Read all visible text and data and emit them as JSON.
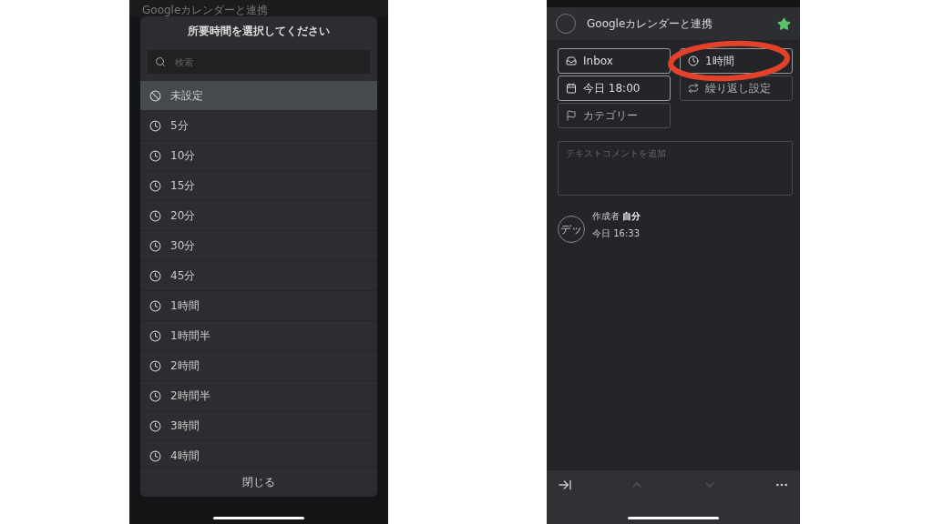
{
  "left_phone": {
    "task_title": "Googleカレンダーと連携",
    "dialog": {
      "title": "所要時間を選択してください",
      "search": {
        "placeholder": "検索"
      },
      "options": [
        {
          "label": "未設定",
          "kind": "none",
          "selected": true
        },
        {
          "label": "5分",
          "kind": "duration",
          "selected": false
        },
        {
          "label": "10分",
          "kind": "duration",
          "selected": false
        },
        {
          "label": "15分",
          "kind": "duration",
          "selected": false
        },
        {
          "label": "20分",
          "kind": "duration",
          "selected": false
        },
        {
          "label": "30分",
          "kind": "duration",
          "selected": false
        },
        {
          "label": "45分",
          "kind": "duration",
          "selected": false
        },
        {
          "label": "1時間",
          "kind": "duration",
          "selected": false
        },
        {
          "label": "1時間半",
          "kind": "duration",
          "selected": false
        },
        {
          "label": "2時間",
          "kind": "duration",
          "selected": false
        },
        {
          "label": "2時間半",
          "kind": "duration",
          "selected": false
        },
        {
          "label": "3時間",
          "kind": "duration",
          "selected": false
        },
        {
          "label": "4時間",
          "kind": "duration",
          "selected": false
        }
      ],
      "close": "閉じる"
    }
  },
  "right_phone": {
    "task": {
      "title": "Googleカレンダーと連携",
      "done": false,
      "starred": true
    },
    "properties": [
      {
        "label": "Inbox",
        "kind": "inbox",
        "set": true
      },
      {
        "label": "1時間",
        "kind": "duration",
        "set": true
      },
      {
        "label": "今日 18:00",
        "kind": "date",
        "set": true
      },
      {
        "label": "繰り返し設定",
        "kind": "repeat",
        "set": false
      },
      {
        "label": "カテゴリー",
        "kind": "category",
        "set": false
      }
    ],
    "comment": {
      "placeholder": "テキストコメントを追加"
    },
    "activity": {
      "avatar": "デッ",
      "author": "作成者 **自分**",
      "time": "今日 16:33"
    },
    "toolbar": [
      {
        "kind": "move",
        "disabled": false
      },
      {
        "kind": "up",
        "disabled": true
      },
      {
        "kind": "down",
        "disabled": true
      },
      {
        "kind": "more",
        "disabled": false
      }
    ]
  }
}
